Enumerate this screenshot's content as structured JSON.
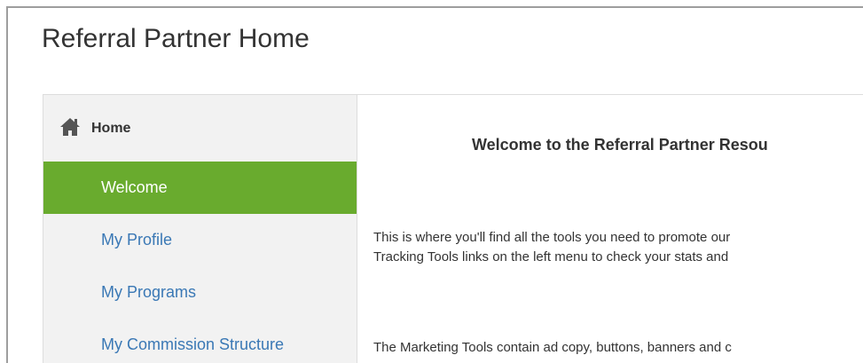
{
  "page": {
    "title": "Referral Partner Home"
  },
  "sidebar": {
    "header": {
      "icon": "home-icon",
      "label": "Home"
    },
    "items": [
      {
        "label": "Welcome",
        "active": true
      },
      {
        "label": "My Profile",
        "active": false
      },
      {
        "label": "My Programs",
        "active": false
      },
      {
        "label": "My Commission Structure",
        "active": false
      }
    ]
  },
  "content": {
    "heading": "Welcome to the Referral Partner Resou",
    "paragraph1": {
      "line1": "This is where you'll find all the tools you need to promote our",
      "line2": "Tracking Tools links on the left menu to check your stats and"
    },
    "paragraph2": {
      "line1": "The Marketing Tools contain ad copy, buttons, banners and c"
    }
  },
  "colors": {
    "active_bg": "#69ab2e",
    "link": "#3a78b5",
    "sidebar_bg": "#f2f2f2"
  }
}
